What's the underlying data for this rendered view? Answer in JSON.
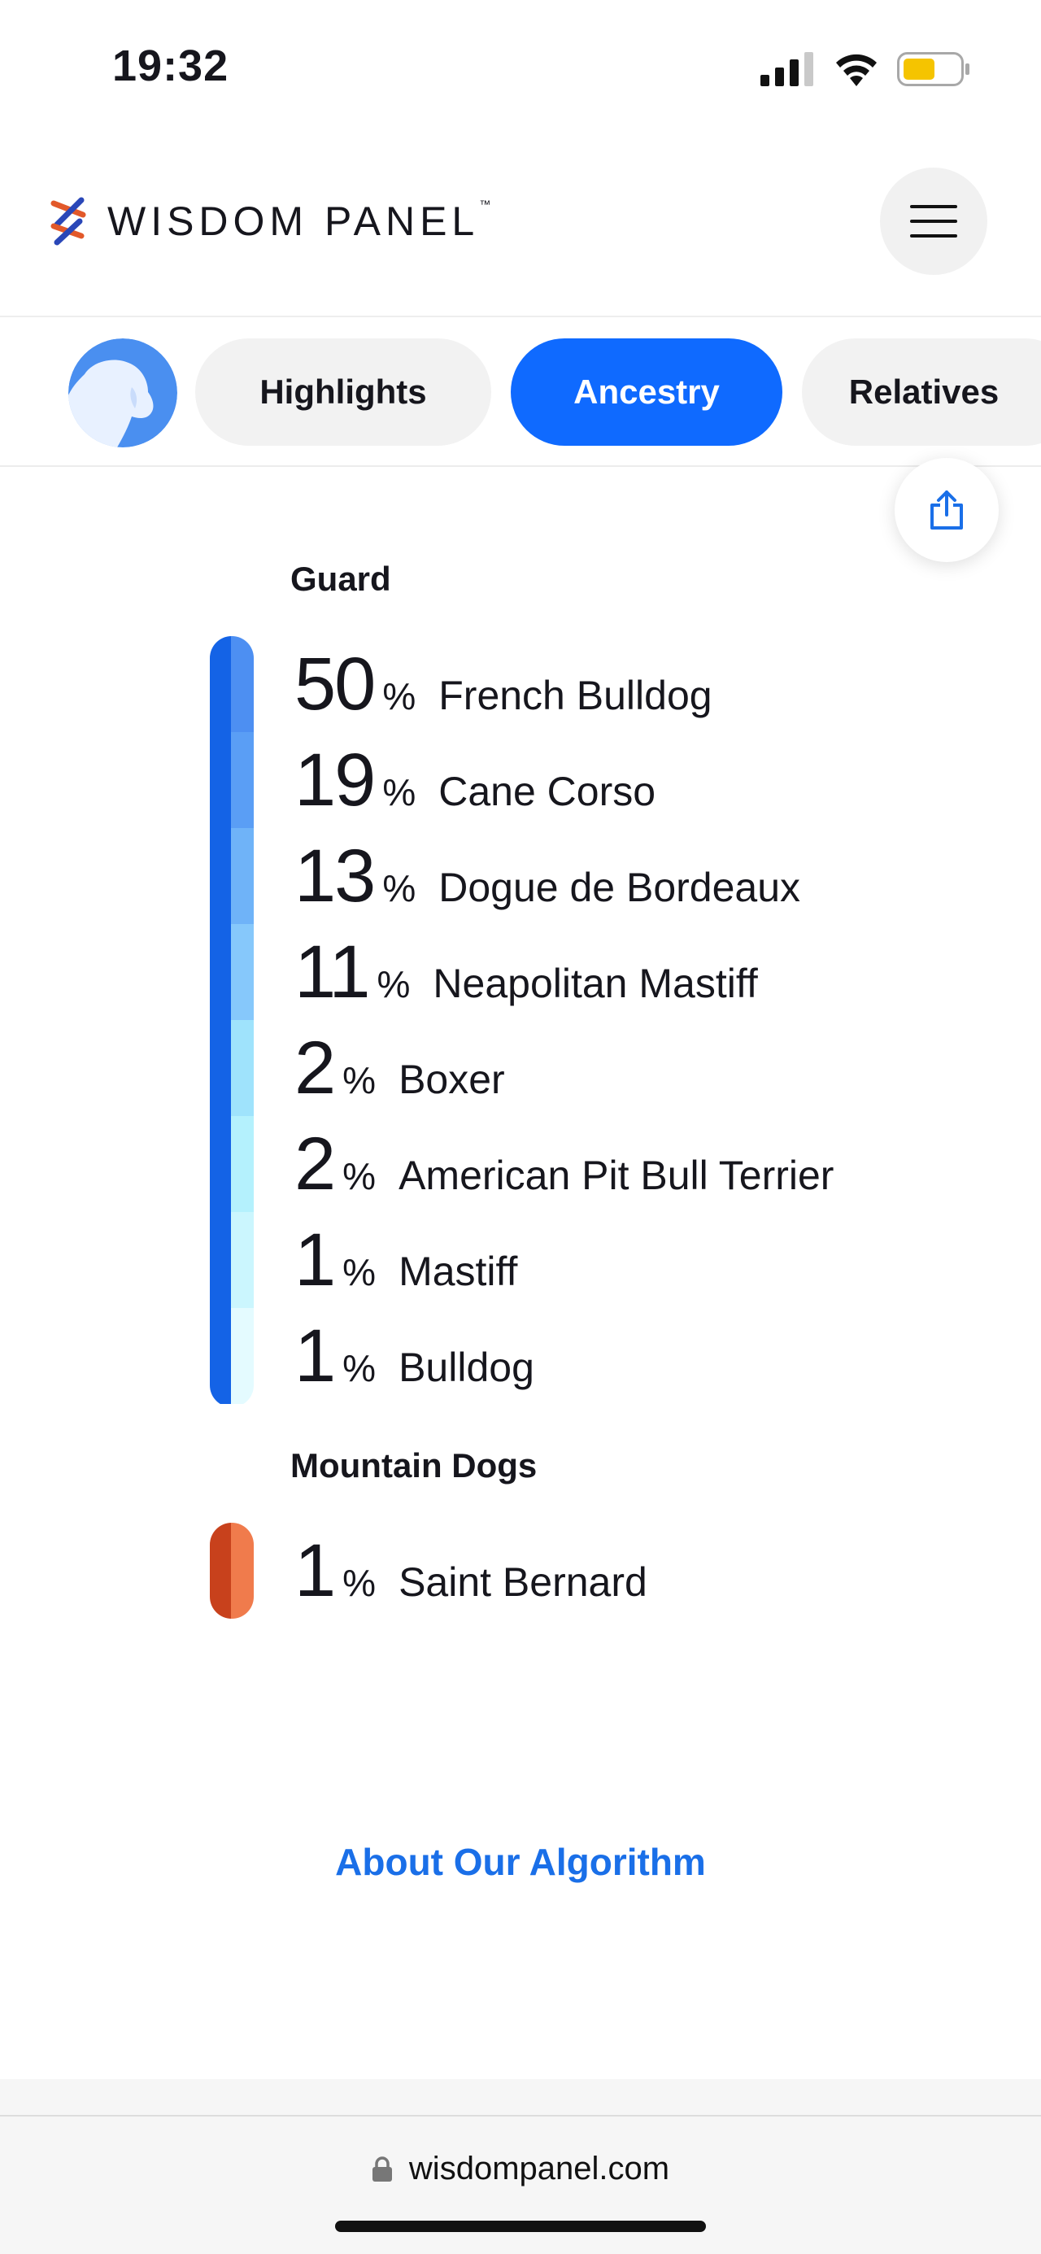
{
  "status_bar": {
    "time": "19:32",
    "battery_color": "#f5c400"
  },
  "header": {
    "brand": "WISDOM PANEL",
    "trademark": "™",
    "menu_icon": "hamburger-icon"
  },
  "tabs": [
    {
      "label": "Highlights",
      "active": false
    },
    {
      "label": "Ancestry",
      "active": true
    },
    {
      "label": "Relatives",
      "active": false
    }
  ],
  "share": {
    "icon": "share-icon"
  },
  "groups": [
    {
      "title": "Guard",
      "bar_colors": {
        "dark": "#1463e6",
        "segments": [
          "#4d8ff2",
          "#5a9ef5",
          "#6fb3f8",
          "#86c8fb",
          "#9fe3fc",
          "#b4f1fd",
          "#cbf6fe",
          "#e4fbff"
        ]
      },
      "breeds": [
        {
          "percent": "50",
          "symbol": "%",
          "name": "French Bulldog"
        },
        {
          "percent": "19",
          "symbol": "%",
          "name": "Cane Corso"
        },
        {
          "percent": "13",
          "symbol": "%",
          "name": "Dogue de Bordeaux"
        },
        {
          "percent": "11",
          "symbol": "%",
          "name": "Neapolitan Mastiff"
        },
        {
          "percent": "2",
          "symbol": "%",
          "name": "Boxer"
        },
        {
          "percent": "2",
          "symbol": "%",
          "name": "American Pit Bull Terrier"
        },
        {
          "percent": "1",
          "symbol": "%",
          "name": "Mastiff"
        },
        {
          "percent": "1",
          "symbol": "%",
          "name": "Bulldog"
        }
      ]
    },
    {
      "title": "Mountain Dogs",
      "bar_colors": {
        "dark": "#c8411c",
        "segments": [
          "#f07b4c"
        ]
      },
      "breeds": [
        {
          "percent": "1",
          "symbol": "%",
          "name": "Saint Bernard"
        }
      ]
    }
  ],
  "footer": {
    "about_link": "About Our Algorithm"
  },
  "browser": {
    "url": "wisdompanel.com"
  }
}
